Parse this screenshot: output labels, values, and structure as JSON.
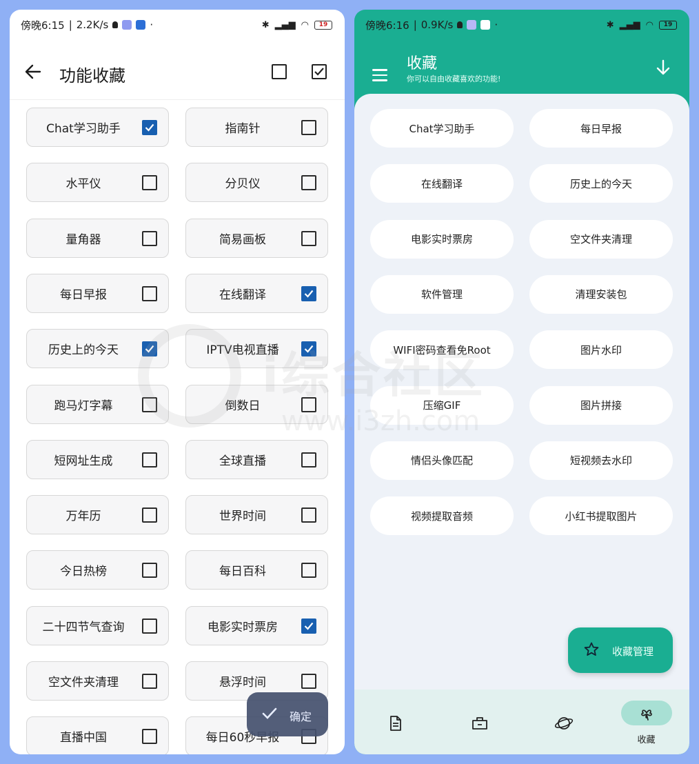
{
  "left_phone": {
    "status": {
      "time": "傍晚6:15",
      "speed": "2.2K/s",
      "battery": "19"
    },
    "title": "功能收藏",
    "items": [
      {
        "label": "Chat学习助手",
        "checked": true
      },
      {
        "label": "指南针",
        "checked": false
      },
      {
        "label": "水平仪",
        "checked": false
      },
      {
        "label": "分贝仪",
        "checked": false
      },
      {
        "label": "量角器",
        "checked": false
      },
      {
        "label": "简易画板",
        "checked": false
      },
      {
        "label": "每日早报",
        "checked": false
      },
      {
        "label": "在线翻译",
        "checked": true
      },
      {
        "label": "历史上的今天",
        "checked": true
      },
      {
        "label": "IPTV电视直播",
        "checked": true
      },
      {
        "label": "跑马灯字幕",
        "checked": false
      },
      {
        "label": "倒数日",
        "checked": false
      },
      {
        "label": "短网址生成",
        "checked": false
      },
      {
        "label": "全球直播",
        "checked": false
      },
      {
        "label": "万年历",
        "checked": false
      },
      {
        "label": "世界时间",
        "checked": false
      },
      {
        "label": "今日热榜",
        "checked": false
      },
      {
        "label": "每日百科",
        "checked": false
      },
      {
        "label": "二十四节气查询",
        "checked": false
      },
      {
        "label": "电影实时票房",
        "checked": true
      },
      {
        "label": "空文件夹清理",
        "checked": false
      },
      {
        "label": "悬浮时间",
        "checked": false
      },
      {
        "label": "直播中国",
        "checked": false
      },
      {
        "label": "每日60秒早报",
        "checked": false
      }
    ],
    "confirm_label": "确定"
  },
  "watermark": {
    "text": "i综合社区",
    "url": "www.i3zh.com"
  },
  "right_phone": {
    "status": {
      "time": "傍晚6:16",
      "speed": "0.9K/s",
      "battery": "19"
    },
    "title": "收藏",
    "subtitle": "你可以自由收藏喜欢的功能!",
    "favorites": [
      "Chat学习助手",
      "每日早报",
      "在线翻译",
      "历史上的今天",
      "电影实时票房",
      "空文件夹清理",
      "软件管理",
      "清理安装包",
      "WIFI密码查看免Root",
      "图片水印",
      "压缩GIF",
      "图片拼接",
      "情侣头像匹配",
      "短视频去水印",
      "视频提取音频",
      "小红书提取图片"
    ],
    "manage_label": "收藏管理",
    "nav": [
      {
        "icon": "document-icon",
        "label": ""
      },
      {
        "icon": "toolbox-icon",
        "label": ""
      },
      {
        "icon": "planet-icon",
        "label": ""
      },
      {
        "icon": "clover-icon",
        "label": "收藏"
      }
    ]
  },
  "colors": {
    "accent_green": "#1aae92",
    "check_blue": "#185fb0",
    "page_bg": "#8fb0f5"
  }
}
